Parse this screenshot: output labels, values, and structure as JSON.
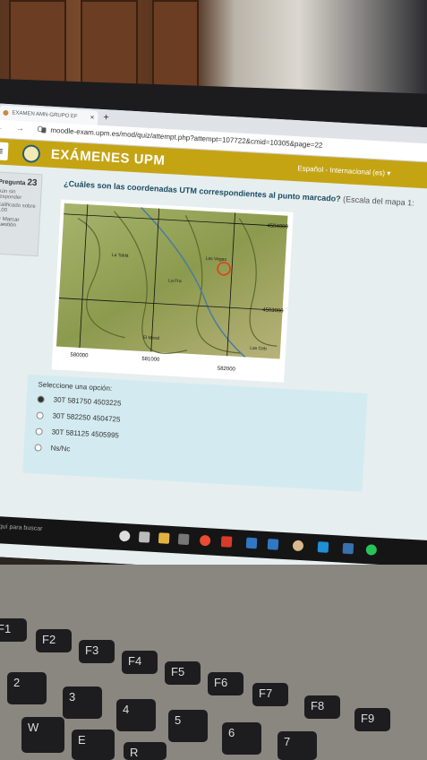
{
  "browser": {
    "tab_title": "EXAMEN AMN-GRUPO EF",
    "tab_close": "×",
    "new_tab": "+",
    "nav_buttons": "← → C",
    "url": "moodle-exam.upm.es/mod/quiz/attempt.php?attempt=107722&cmid=10305&page=22"
  },
  "header": {
    "menu_icon": "≡",
    "brand": "EXÁMENES UPM",
    "language": "Español - Internacional (es) ▾"
  },
  "question_info": {
    "label": "Pregunta",
    "number": "23",
    "status": "Aún sin responder",
    "grade": "Calificado sobre 1.00",
    "flag": "Marcar cuestión"
  },
  "question": {
    "text": "¿Cuáles son las coordenadas UTM correspondientes al punto marcado?",
    "suffix": "(Escala del mapa 1:"
  },
  "map": {
    "y_labels": [
      "4504000",
      "4503000"
    ],
    "x_labels": [
      "580000",
      "581000",
      "582000"
    ],
    "place_names": [
      "La Tablá",
      "Las Vegas",
      "La Fra",
      "El Moral",
      "Las Ceb"
    ]
  },
  "answer": {
    "prompt": "Seleccione una opción:",
    "options": [
      "30T 581750 4503225",
      "30T 582250 4504725",
      "30T 581125 4505995",
      "Ns/Nc"
    ],
    "selected_index": 0
  },
  "taskbar": {
    "search_placeholder": "Escribe aquí para buscar"
  },
  "keyboard": {
    "keys": [
      "F1",
      "F2",
      "F3",
      "F4",
      "F5",
      "F6",
      "F7",
      "F8",
      "F9",
      "2",
      "3",
      "4",
      "5",
      "6",
      "7",
      "W",
      "E",
      "R",
      "@",
      "#",
      "$",
      "%",
      "&",
      "/"
    ]
  },
  "colors": {
    "moodle_bar": "#c5a414",
    "answer_box": "#d3ebf0",
    "marker": "#e0401a"
  }
}
